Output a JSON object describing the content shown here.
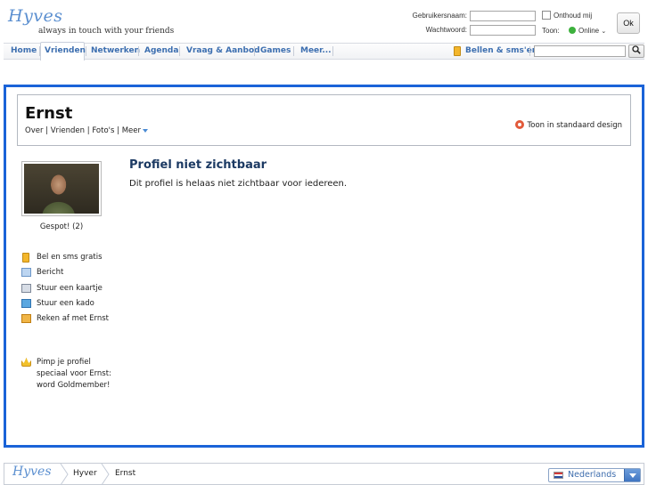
{
  "header": {
    "logo_word": "Hyves",
    "tagline": "always in touch with your friends",
    "username_label": "Gebruikersnaam:",
    "password_label": "Wachtwoord:",
    "remember_label": "Onthoud mij",
    "show_label": "Toon:",
    "online_label": "Online",
    "ok_label": "Ok"
  },
  "nav": {
    "items": [
      "Home",
      "Vrienden",
      "Netwerken",
      "Agenda",
      "Vraag & Aanbod",
      "Games",
      "Meer..."
    ],
    "active": "Vrienden",
    "call_sms": "Bellen & sms'en",
    "search_value": "",
    "search_icon": "magnifier-icon"
  },
  "profile": {
    "name": "Ernst",
    "links": [
      "Over",
      "Vrienden",
      "Foto's",
      "Meer"
    ],
    "std_design": "Toon in standaard design",
    "gespot": "Gespot! (2)",
    "actions": [
      {
        "icon": "phone-icon",
        "label": "Bel en sms gratis"
      },
      {
        "icon": "envelope-icon",
        "label": "Bericht"
      },
      {
        "icon": "card-icon",
        "label": "Stuur een kaartje"
      },
      {
        "icon": "gift-icon",
        "label": "Stuur een kado"
      },
      {
        "icon": "calculator-icon",
        "label": "Reken af met Ernst"
      }
    ],
    "pimp": {
      "icon": "crown-icon",
      "label": "Pimp je profiel speciaal voor Ernst: word Goldmember!"
    },
    "content_title": "Profiel niet zichtbaar",
    "content_text": "Dit profiel is helaas niet zichtbaar voor iedereen."
  },
  "footer": {
    "logo_word": "Hyves",
    "crumbs": [
      "Hyver",
      "Ernst"
    ],
    "language": "Nederlands"
  },
  "colors": {
    "frame_blue": "#1a63d8",
    "link_blue": "#3d6fb0",
    "title_navy": "#1c3a63"
  }
}
